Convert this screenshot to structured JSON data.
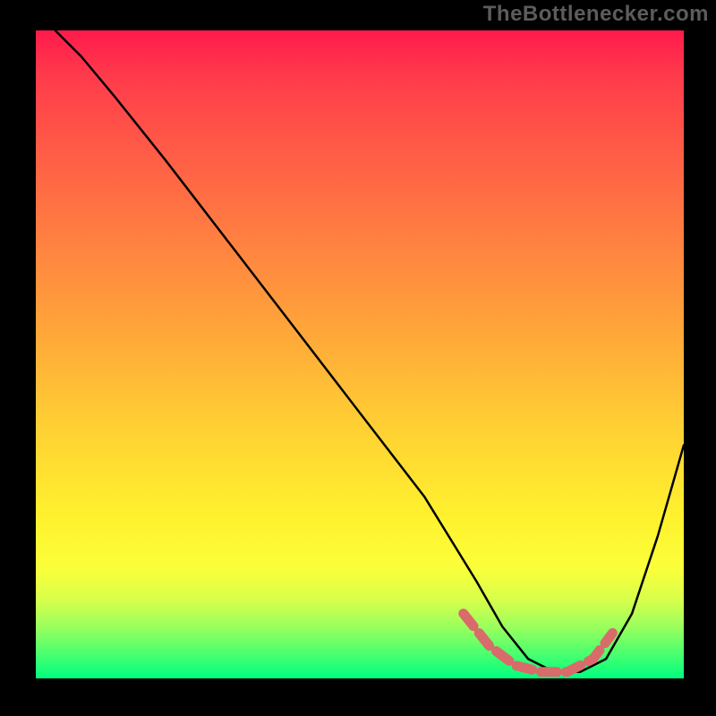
{
  "watermark": "TheBottlenecker.com",
  "chart_data": {
    "type": "line",
    "title": "",
    "xlabel": "",
    "ylabel": "",
    "xlim": [
      0,
      100
    ],
    "ylim": [
      0,
      100
    ],
    "series": [
      {
        "name": "bottleneck-curve",
        "x": [
          3,
          7,
          12,
          20,
          30,
          40,
          50,
          60,
          68,
          72,
          76,
          80,
          84,
          88,
          92,
          96,
          100
        ],
        "y": [
          100,
          96,
          90,
          80,
          67,
          54,
          41,
          28,
          15,
          8,
          3,
          1,
          1,
          3,
          10,
          22,
          36
        ]
      }
    ],
    "highlight": {
      "name": "optimal-range",
      "x": [
        66,
        70,
        74,
        78,
        82,
        86,
        89
      ],
      "y": [
        10,
        5,
        2,
        1,
        1,
        3,
        7
      ]
    },
    "colors": {
      "curve": "#000000",
      "highlight": "#d96b6b",
      "gradient_top": "#ff1a4b",
      "gradient_bottom": "#00ff80"
    }
  }
}
